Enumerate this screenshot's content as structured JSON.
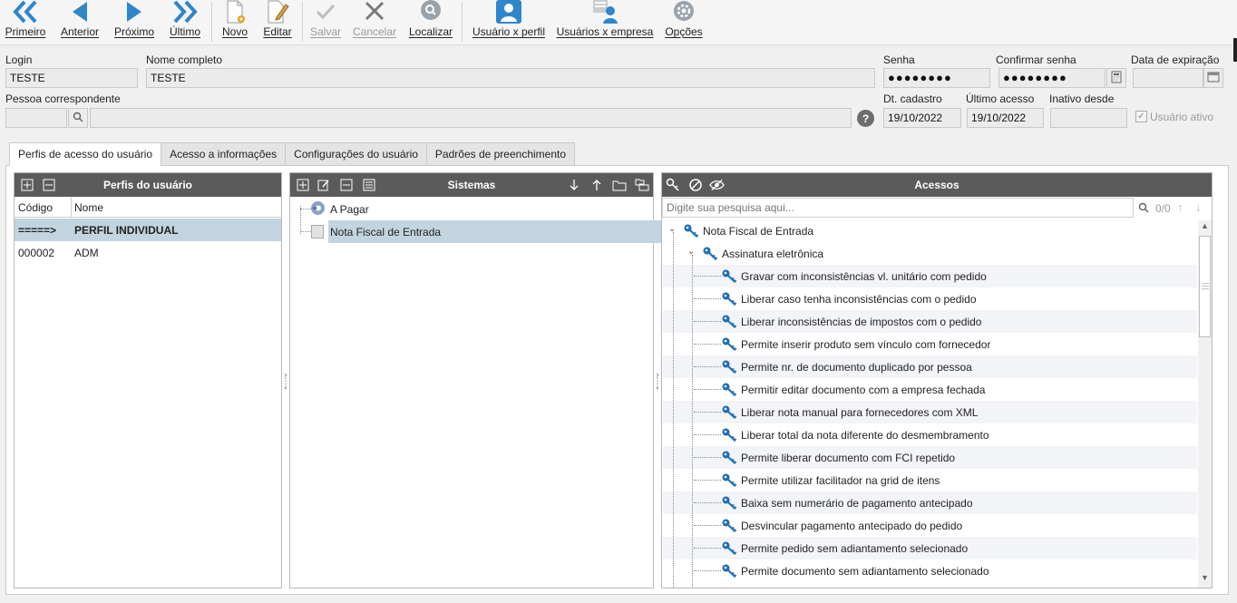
{
  "toolbar": {
    "first": "Primeiro",
    "previous": "Anterior",
    "next": "Próximo",
    "last": "Último",
    "new": "Novo",
    "edit": "Editar",
    "save": "Salvar",
    "cancel": "Cancelar",
    "search": "Localizar",
    "user_profile": "Usuário x perfil",
    "user_company": "Usuários x empresa",
    "options": "Opções"
  },
  "form": {
    "login_label": "Login",
    "login_value": "TESTE",
    "fullname_label": "Nome completo",
    "fullname_value": "TESTE",
    "password_label": "Senha",
    "password_value": "●●●●●●●●",
    "confirm_label": "Confirmar senha",
    "confirm_value": "●●●●●●●●",
    "expiration_label": "Data de expiração",
    "expiration_value": "",
    "person_label": "Pessoa correspondente",
    "person_code": "",
    "person_name": "",
    "created_label": "Dt. cadastro",
    "created_value": "19/10/2022",
    "last_access_label": "Último acesso",
    "last_access_value": "19/10/2022",
    "inactive_label": "Inativo desde",
    "inactive_value": "",
    "active_user_label": "Usuário ativo"
  },
  "tabs": [
    {
      "label": "Perfis de acesso do usuário"
    },
    {
      "label": "Acesso a informações"
    },
    {
      "label": "Configurações do usuário"
    },
    {
      "label": "Padrões de preenchimento"
    }
  ],
  "profiles": {
    "title": "Perfis do usuário",
    "col_code": "Código",
    "col_name": "Nome",
    "rows": [
      {
        "code": "=====>",
        "name": "PERFIL INDIVIDUAL"
      },
      {
        "code": "000002",
        "name": "ADM"
      }
    ]
  },
  "systems": {
    "title": "Sistemas",
    "items": [
      {
        "label": "A Pagar"
      },
      {
        "label": "Nota Fiscal de Entrada"
      }
    ]
  },
  "access": {
    "title": "Acessos",
    "search_placeholder": "Digite sua pesquisa aqui...",
    "search_count": "0/0",
    "root": "Nota Fiscal de Entrada",
    "group": "Assinatura eletrônica",
    "items": [
      "Gravar com inconsistências vl. unitário com pedido",
      "Liberar caso tenha inconsistências com o pedido",
      "Liberar inconsistências de impostos com o pedido",
      "Permite inserir produto sem vínculo com fornecedor",
      "Permite nr. de documento duplicado por pessoa",
      "Permitir editar documento com a empresa fechada",
      "Liberar nota manual para fornecedores com XML",
      "Liberar total da nota diferente do desmembramento",
      "Permite liberar documento com FCI repetido",
      "Permite utilizar facilitador na grid de itens",
      "Baixa sem numerário de pagamento antecipado",
      "Desvincular pagamento antecipado do pedido",
      "Permite pedido sem adiantamento selecionado",
      "Permite documento sem adiantamento selecionado"
    ]
  }
}
